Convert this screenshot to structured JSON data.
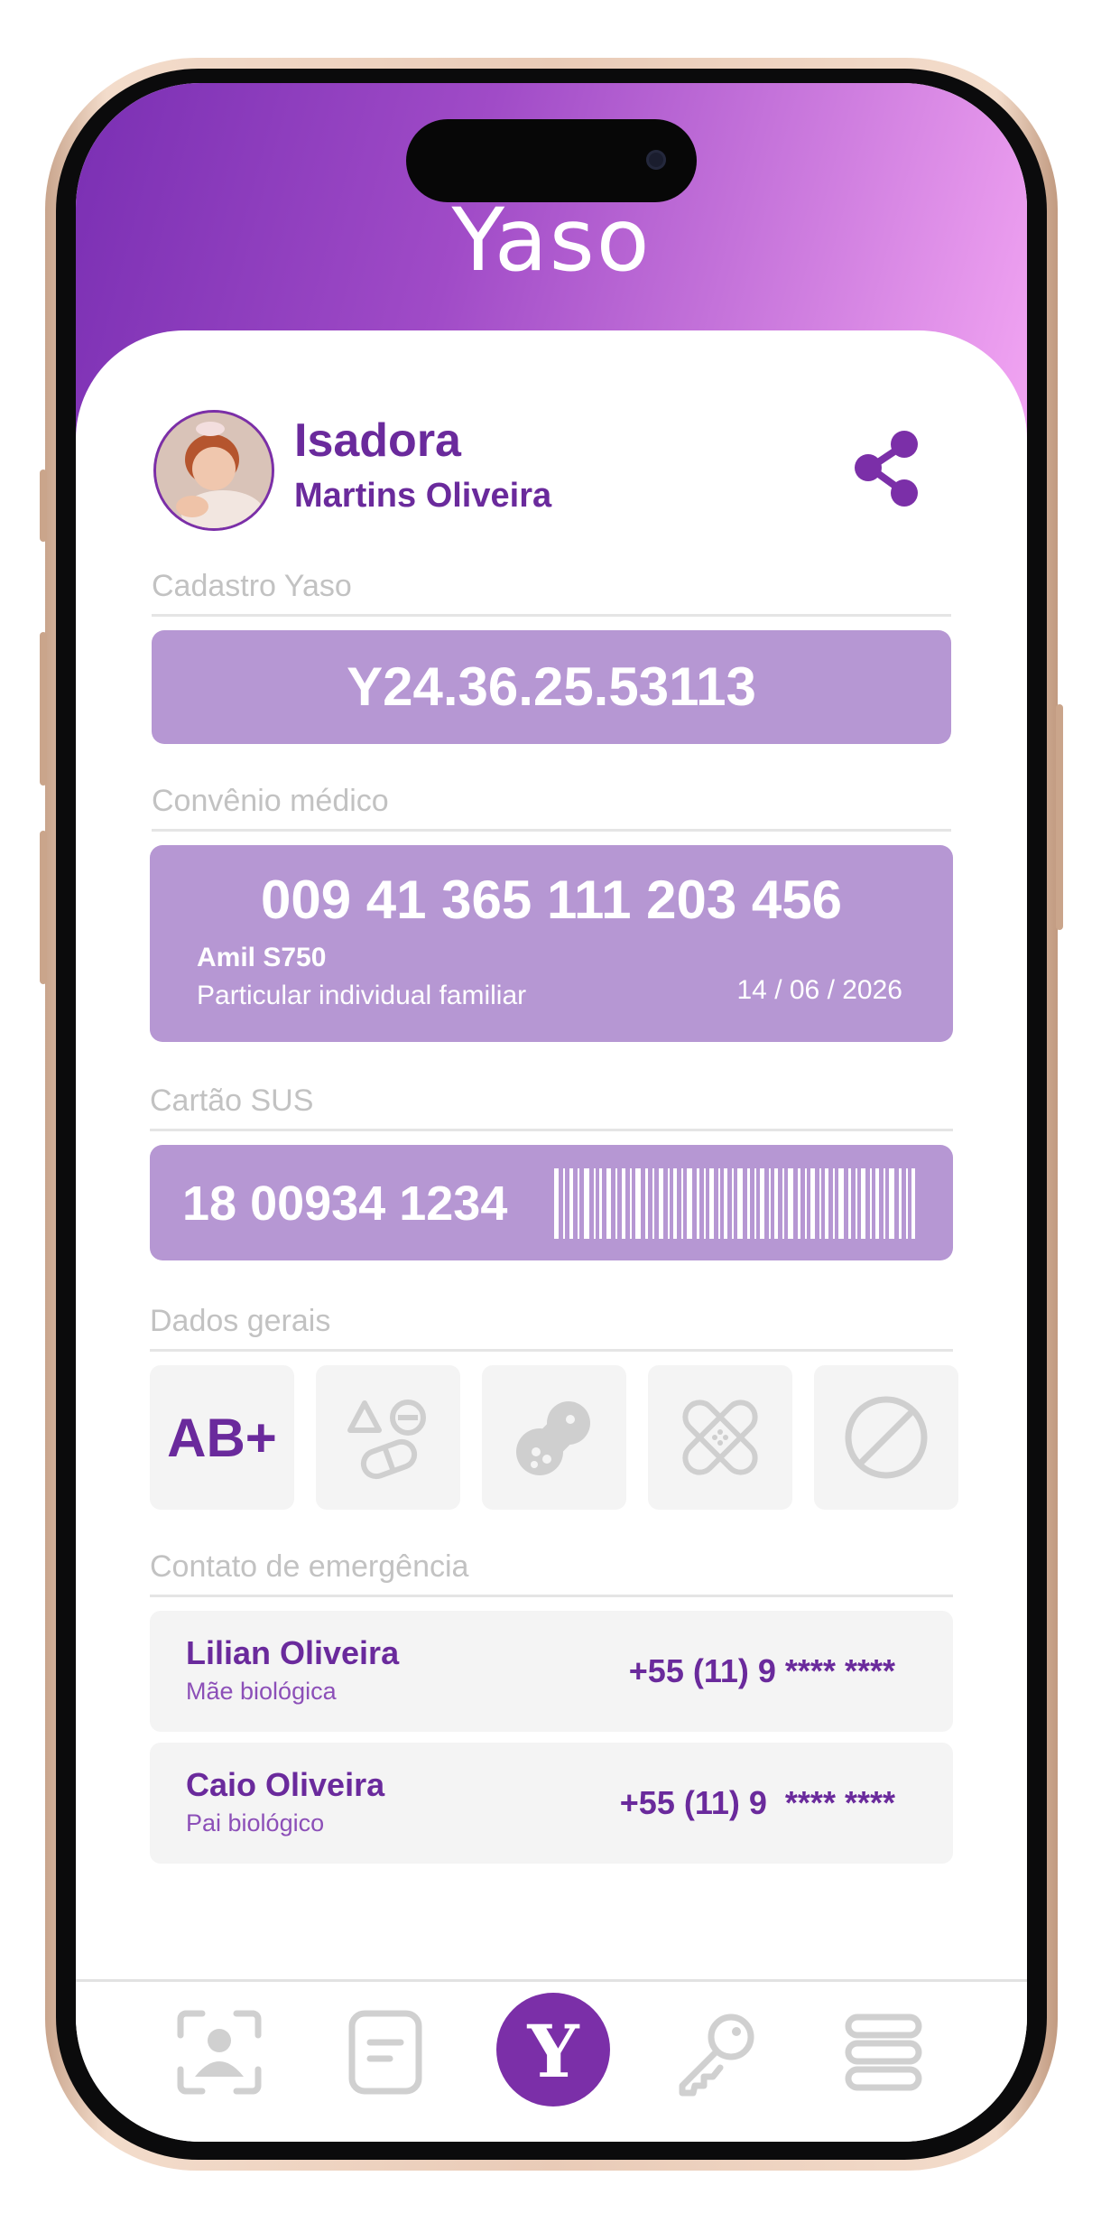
{
  "app": {
    "logo": "Yaso"
  },
  "profile": {
    "first_name": "Isadora",
    "last_name": "Martins Oliveira"
  },
  "yaso": {
    "label": "Cadastro Yaso",
    "id": "Y24.36.25.53113"
  },
  "convenio": {
    "label": "Convênio médico",
    "number": "009 41 365 111 203 456",
    "plan": "Amil S750",
    "type": "Particular individual familiar",
    "expiry": "14 / 06 / 2026"
  },
  "sus": {
    "label": "Cartão SUS",
    "number": "18 00934 1234"
  },
  "dados": {
    "label": "Dados gerais",
    "blood_type": "AB+",
    "icons": [
      "medications-icon",
      "allergy-icon",
      "bandage-icon",
      "blocked-icon"
    ]
  },
  "emergency": {
    "label": "Contato de emergência",
    "contacts": [
      {
        "name": "Lilian Oliveira",
        "relation": "Mãe biológica",
        "phone": "+55 (11) 9 **** ****"
      },
      {
        "name": "Caio Oliveira",
        "relation": "Pai biológico",
        "phone": "+55 (11) 9  **** ****"
      }
    ]
  },
  "nav": {
    "items": [
      "face-scan-icon",
      "note-icon",
      "yaso-home-icon",
      "key-icon",
      "menu-icon"
    ],
    "center_glyph": "Y"
  },
  "colors": {
    "accent": "#6a2a9c",
    "box": "#b697d3",
    "header_start": "#7a2fb3",
    "header_end": "#f3a6f3"
  }
}
